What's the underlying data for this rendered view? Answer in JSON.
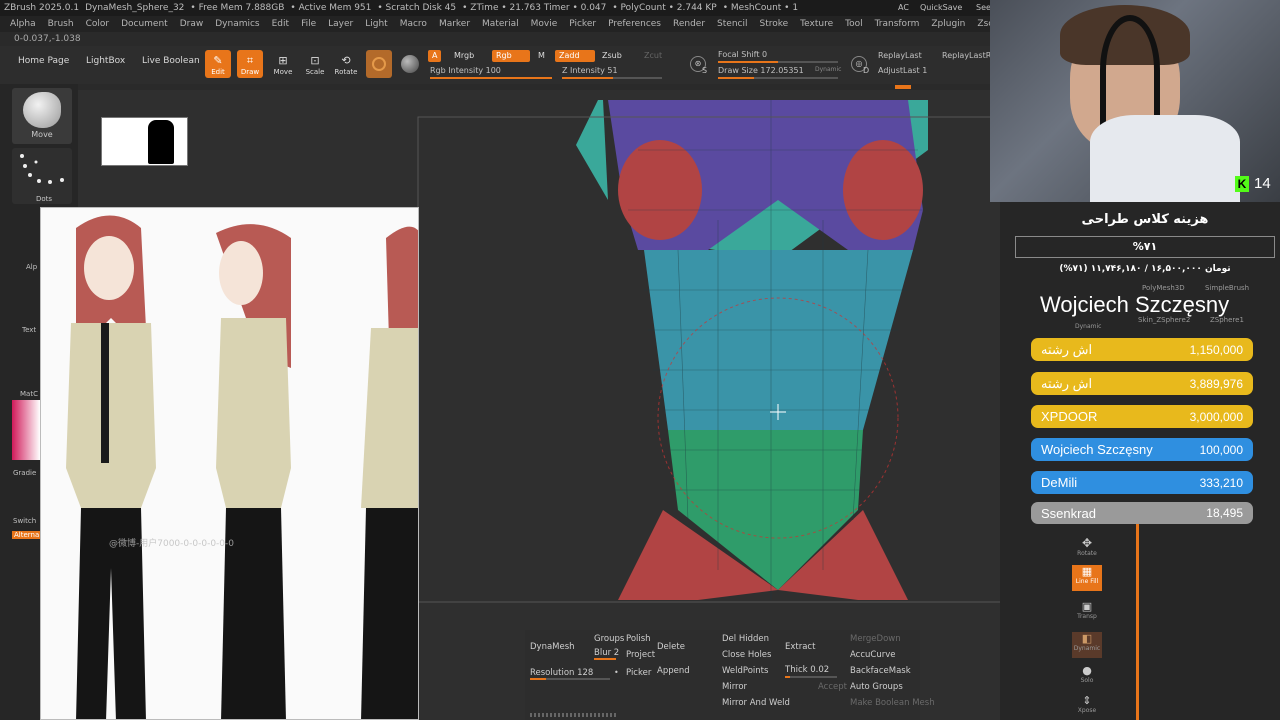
{
  "titlebar": {
    "app": "ZBrush 2025.0.1",
    "document": "DynaMesh_Sphere_32",
    "free_mem": "• Free Mem 7.888GB",
    "active_mem": "• Active Mem 951",
    "scratch": "• Scratch Disk 45",
    "ztime": "• ZTime • 21.763 Timer • 0.047",
    "polycount": "• PolyCount • 2.744 KP",
    "meshcount": "• MeshCount • 1",
    "ac": "AC",
    "quicksave": "QuickSave",
    "see": "See"
  },
  "menu": [
    "Alpha",
    "Brush",
    "Color",
    "Document",
    "Draw",
    "Dynamics",
    "Edit",
    "File",
    "Layer",
    "Light",
    "Macro",
    "Marker",
    "Material",
    "Movie",
    "Picker",
    "Preferences",
    "Render",
    "Stencil",
    "Stroke",
    "Texture",
    "Tool",
    "Transform",
    "Zplugin",
    "Zscript",
    "Help"
  ],
  "coords": "0-0.037,-1.038",
  "nav": {
    "home": "Home Page",
    "lightbox": "LightBox",
    "liveboolean": "Live Boolean"
  },
  "tools": {
    "edit": "Edit",
    "draw": "Draw",
    "move": "Move",
    "scale": "Scale",
    "rotate": "Rotate"
  },
  "brushctl": {
    "a": "A",
    "mrgb": "Mrgb",
    "rgb": "Rgb",
    "m": "M",
    "zadd": "Zadd",
    "zsub": "Zsub",
    "zcut": "Zcut",
    "rgb_intensity": "Rgb Intensity 100",
    "z_intensity": "Z Intensity 51",
    "focal_shift": "Focal Shift 0",
    "draw_size": "Draw Size 172.05351",
    "dynamic": "Dynamic",
    "replay_last": "ReplayLast",
    "replay_last_rel": "ReplayLastRe",
    "adjust_last": "AdjustLast 1",
    "s": "S",
    "d": "D"
  },
  "leftpanel": {
    "move": "Move",
    "dots": "Dots",
    "alpha": "Alp",
    "texture": "Text",
    "matcap": "MatC",
    "gradient": "Gradie",
    "switch": "Switch",
    "alternate": "Alterna"
  },
  "reference": {
    "watermark": "@微博-用户7000-0-0-0-0-0-0"
  },
  "donation": {
    "title": "هزینه کلاس طراحی",
    "percent": "%۷۱",
    "amount_line": "(%۷۱) ۱۱,۷۴۶,۱۸۰ / ۱۶,۵۰۰,۰۰۰ تومان"
  },
  "subtool_labels": {
    "polymesh": "PolyMesh3D",
    "simplebrush": "SimpleBrush",
    "skin1": "Skin_ZSphere2",
    "zsphere": "ZSphere1",
    "dynamic": "Dynamic",
    "zsphere2": "ZSphere2",
    "skin2": "Skin_ZSphere1"
  },
  "leaderboard": {
    "heading": "Wojciech Szczęsny",
    "rows": [
      {
        "name": "اش رشته",
        "amount": "1,150,000",
        "color": "#e8b91c"
      },
      {
        "name": "اش رشته",
        "amount": "3,889,976",
        "color": "#e8b91c"
      },
      {
        "name": "XPDOOR",
        "amount": "3,000,000",
        "color": "#e8b91c"
      },
      {
        "name": "Wojciech Szczęsny",
        "amount": "100,000",
        "color": "#2f8fe0"
      },
      {
        "name": "DeMili",
        "amount": "333,210",
        "color": "#2f8fe0"
      },
      {
        "name": "Ssenkrad",
        "amount": "18,495",
        "color": "#9a9a9a"
      }
    ]
  },
  "kick": {
    "count": "14"
  },
  "righttools": {
    "rotate": "Rotate",
    "linefill": "Line Fill",
    "transp": "Transp",
    "dynamic": "Dynamic",
    "solo": "Solo",
    "xpose": "Xpose"
  },
  "dynamesh": {
    "dynamesh": "DynaMesh",
    "groups": "Groups",
    "polish": "Polish",
    "blur": "Blur 2",
    "project": "Project",
    "resolution": "Resolution 128",
    "delete": "Delete",
    "append": "Append",
    "picker": "Picker",
    "del_hidden": "Del Hidden",
    "close_holes": "Close Holes",
    "weldpoints": "WeldPoints",
    "mirror": "Mirror",
    "mirror_weld": "Mirror And Weld",
    "extract": "Extract",
    "thick": "Thick 0.02",
    "accept": "Accept",
    "merge_down": "MergeDown",
    "accucurve": "AccuCurve",
    "backface": "BackfaceMask",
    "autogroups": "Auto Groups",
    "make_boolean": "Make Boolean Mesh"
  },
  "colors": {
    "accent": "#e8751a",
    "ui_bg": "#2a2a2a",
    "mesh_purple": "#5a4aa0",
    "mesh_teal": "#3aa89a",
    "mesh_green": "#2f9c6a",
    "mesh_red": "#b14444",
    "kick_green": "#53fc18"
  }
}
